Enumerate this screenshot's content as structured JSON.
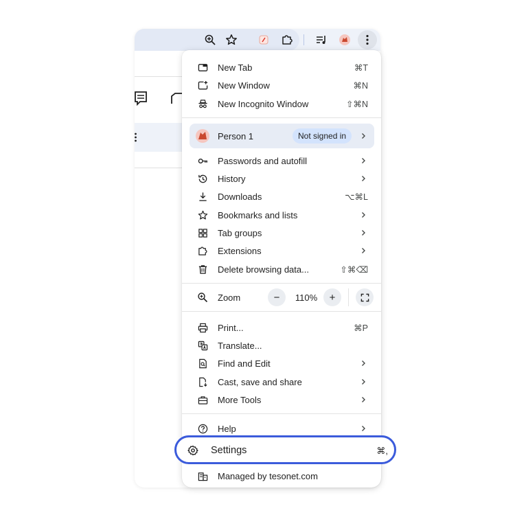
{
  "menu": {
    "new_tab": {
      "label": "New Tab",
      "shortcut": "⌘T"
    },
    "new_window": {
      "label": "New Window",
      "shortcut": "⌘N"
    },
    "new_incognito": {
      "label": "New Incognito Window",
      "shortcut": "⇧⌘N"
    },
    "profile": {
      "name": "Person 1",
      "status": "Not signed in"
    },
    "passwords": {
      "label": "Passwords and autofill"
    },
    "history": {
      "label": "History"
    },
    "downloads": {
      "label": "Downloads",
      "shortcut": "⌥⌘L"
    },
    "bookmarks": {
      "label": "Bookmarks and lists"
    },
    "tab_groups": {
      "label": "Tab groups"
    },
    "extensions": {
      "label": "Extensions"
    },
    "delete_data": {
      "label": "Delete browsing data...",
      "shortcut": "⇧⌘⌫"
    },
    "zoom": {
      "label": "Zoom",
      "decrease": "−",
      "value": "110%",
      "increase": "+"
    },
    "print": {
      "label": "Print...",
      "shortcut": "⌘P"
    },
    "translate": {
      "label": "Translate..."
    },
    "find_edit": {
      "label": "Find and Edit"
    },
    "cast_save": {
      "label": "Cast, save and share"
    },
    "more_tools": {
      "label": "More Tools"
    },
    "help": {
      "label": "Help"
    },
    "settings": {
      "label": "Settings",
      "shortcut": "⌘,"
    },
    "managed": {
      "label": "Managed by tesonet.com"
    }
  },
  "colors": {
    "accent_outline": "#3b5bdb",
    "profile_bg": "#e7ecf5",
    "badge_bg": "#d3e3fd",
    "toolbar_bg": "#eef2f9"
  },
  "icons": {
    "toolbar": [
      "zoom-icon",
      "bookmark-star-icon",
      "extension-app-icon",
      "puzzle-icon",
      "media-queue-icon",
      "profile-avatar-icon",
      "kebab-menu-icon"
    ]
  }
}
